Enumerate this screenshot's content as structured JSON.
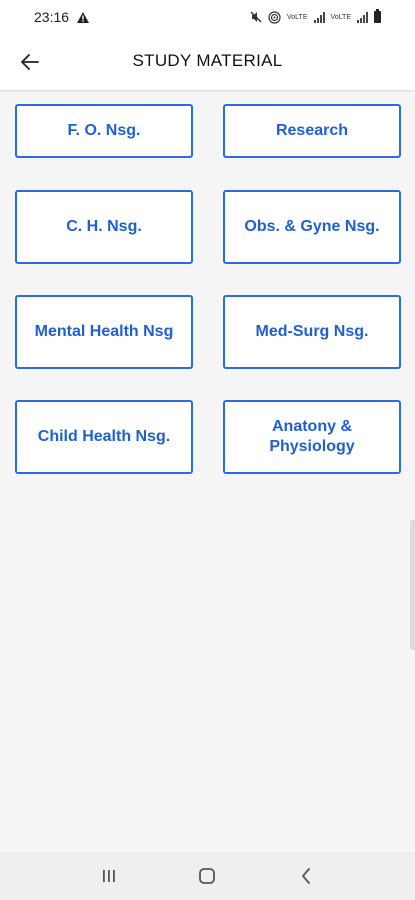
{
  "status_bar": {
    "time": "23:16",
    "net_label_1": "VoLTE",
    "net_label_2": "VoLTE"
  },
  "app_bar": {
    "title": "STUDY MATERIAL",
    "back_icon": "arrow-left-icon"
  },
  "tiles": [
    {
      "label": "F. O. Nsg."
    },
    {
      "label": "Research"
    },
    {
      "label": "C. H. Nsg."
    },
    {
      "label": "Obs. & Gyne Nsg."
    },
    {
      "label": "Mental Health Nsg"
    },
    {
      "label": "Med-Surg Nsg."
    },
    {
      "label": "Child Health Nsg."
    },
    {
      "label": "Anatony & Physiology"
    }
  ],
  "nav_bar": {
    "recents_icon": "recents-icon",
    "home_icon": "home-icon",
    "back_icon": "back-chevron-icon"
  },
  "colors": {
    "accent": "#1f5fd6",
    "border": "#2a6be0",
    "background": "#f5f5f5"
  }
}
